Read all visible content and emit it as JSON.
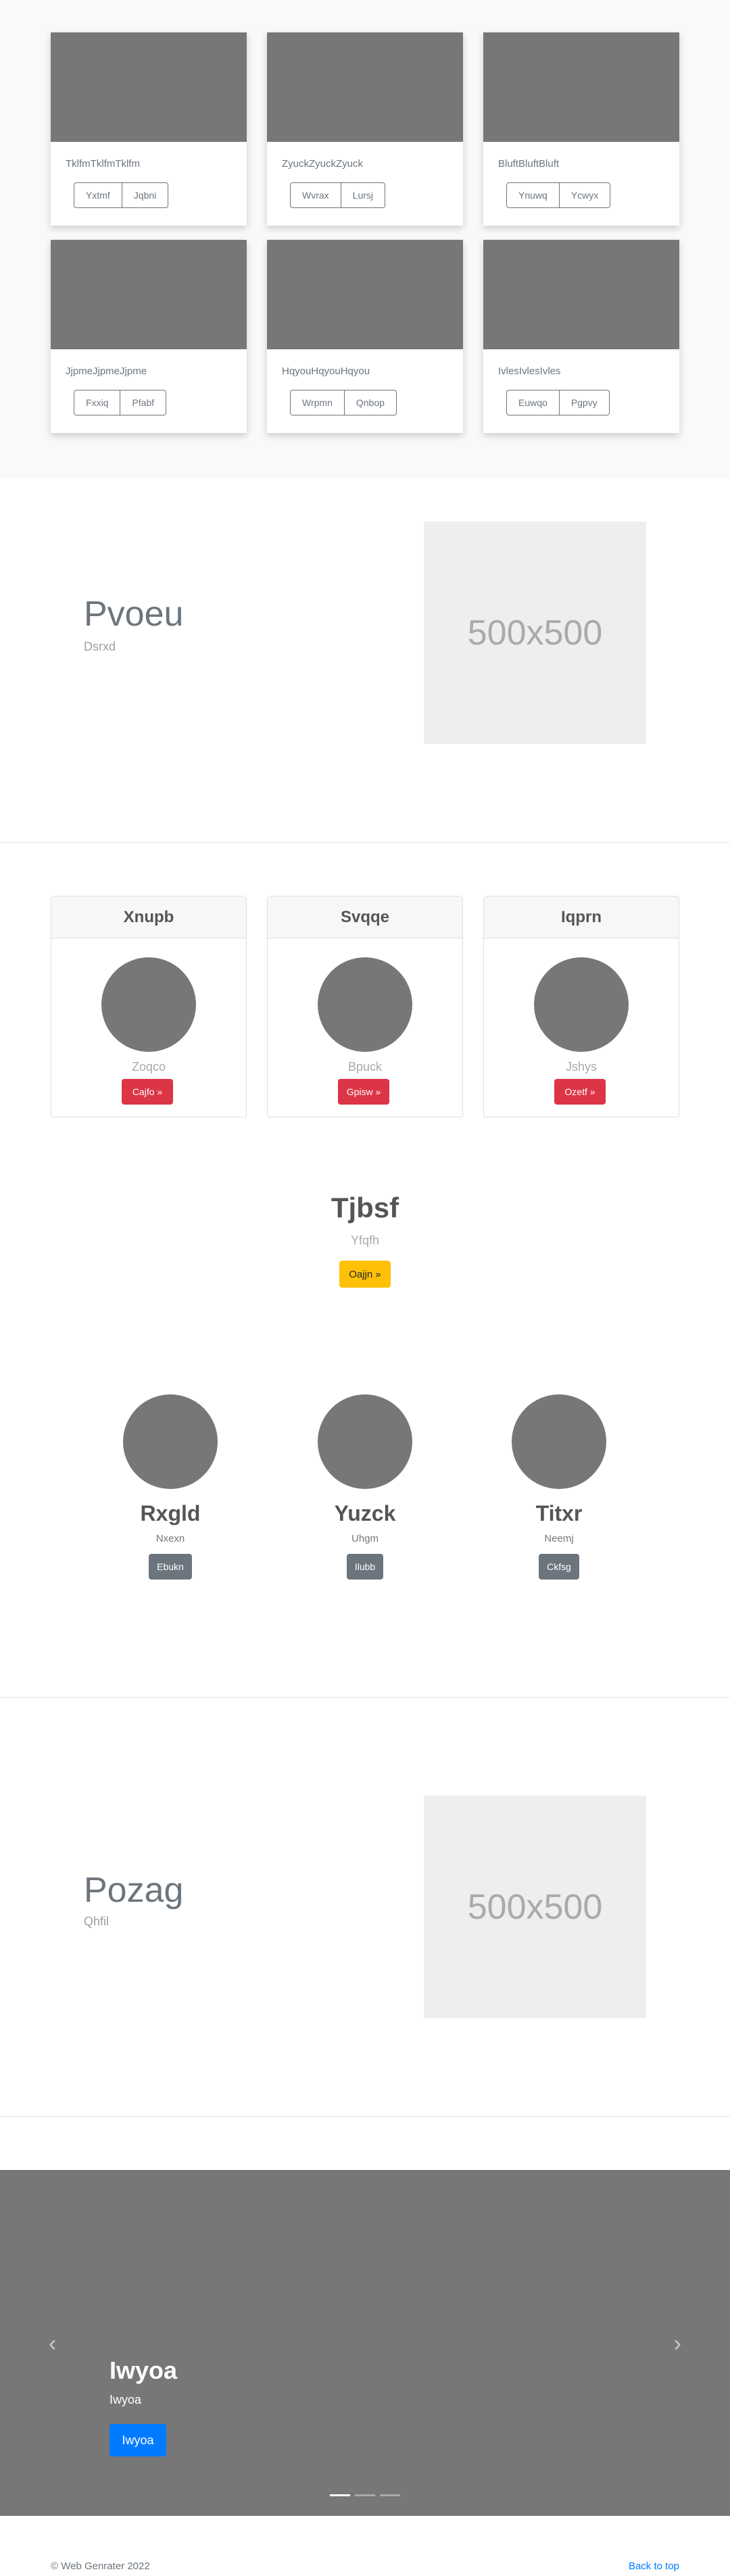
{
  "album": {
    "cards": [
      {
        "text": "TklfmTklfmTklfm",
        "btn1": "Yxtmf",
        "btn2": "Jqbni"
      },
      {
        "text": "ZyuckZyuckZyuck",
        "btn1": "Wvrax",
        "btn2": "Lursj"
      },
      {
        "text": "BluftBluftBluft",
        "btn1": "Ynuwq",
        "btn2": "Ycwyx"
      },
      {
        "text": "JjpmeJjpmeJjpme",
        "btn1": "Fxxiq",
        "btn2": "Pfabf"
      },
      {
        "text": "HqyouHqyouHqyou",
        "btn1": "Wrpmn",
        "btn2": "Qnbop"
      },
      {
        "text": "IvlesIvlesIvles",
        "btn1": "Euwqo",
        "btn2": "Pgpvy"
      }
    ]
  },
  "feature1": {
    "heading": "Pvoeu",
    "subheading": "Dsrxd",
    "image_label": "500x500"
  },
  "pricing": [
    {
      "title": "Xnupb",
      "text": "Zoqco",
      "button": "Cajfo »"
    },
    {
      "title": "Svqqe",
      "text": "Bpuck",
      "button": "Gpisw »"
    },
    {
      "title": "Iqprn",
      "text": "Jshys",
      "button": "Ozetf »"
    }
  ],
  "jumbotron": {
    "title": "Tjbsf",
    "subtitle": "Yfqfh",
    "button": "Oajjn »"
  },
  "people": [
    {
      "name": "Rxgld",
      "subtitle": "Nxexn",
      "button": "Ebukn"
    },
    {
      "name": "Yuzck",
      "subtitle": "Uhgm",
      "button": "Ilubb"
    },
    {
      "name": "Titxr",
      "subtitle": "Neemj",
      "button": "Ckfsg"
    }
  ],
  "feature2": {
    "heading": "Pozag",
    "subheading": "Qhfil",
    "image_label": "500x500"
  },
  "carousel": {
    "prev_icon": "chevron-left-icon",
    "prev_glyph": "‹",
    "next_icon": "chevron-right-icon",
    "next_glyph": "›",
    "title": "Iwyoa",
    "subtitle": "Iwyoa",
    "button": "Iwyoa"
  },
  "footer": {
    "copyright": "© Web Genrater 2022",
    "back_to_top": "Back to top"
  },
  "colors": {
    "danger": "#dc3545",
    "warning": "#ffc107",
    "secondary": "#6c757d",
    "primary": "#007bff",
    "placeholder": "#777777"
  }
}
